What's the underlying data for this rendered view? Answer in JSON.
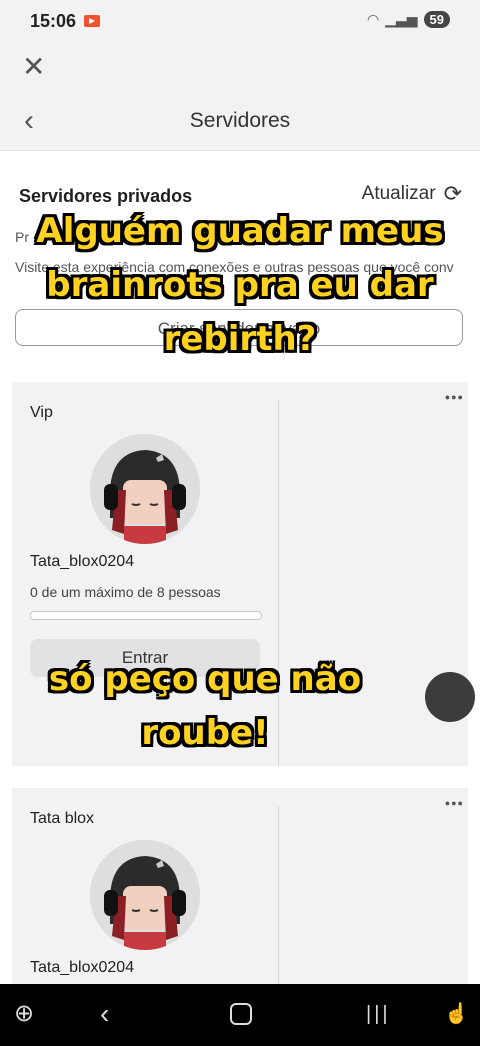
{
  "status_bar": {
    "time": "15:06",
    "battery": "59",
    "wifi_icon": "wifi-icon",
    "signal_icon": "signal-icon"
  },
  "header": {
    "title": "Servidores"
  },
  "private_servers": {
    "title": "Servidores privados",
    "refresh_label": "Atualizar",
    "hint_line1": "Pr",
    "hint_line2": "Visite esta experiência com conexões e outras pessoas que você conv",
    "create_button_label": "Criar servidor privado"
  },
  "servers": [
    {
      "name": "Vip",
      "owner": "Tata_blox0204",
      "capacity": "0 de um máximo de 8 pessoas",
      "fill_fraction": 0,
      "join_label": "Entrar"
    },
    {
      "name": "Tata blox",
      "owner": "Tata_blox0204"
    }
  ],
  "captions": {
    "top": "Alguém guadar meus brainrots pra eu dar rebirth?",
    "bottom": "só peço que não roube!"
  },
  "colors": {
    "caption": "#ffd21f",
    "card_bg": "#f2f2f4",
    "accent_record": "#f0522f"
  }
}
